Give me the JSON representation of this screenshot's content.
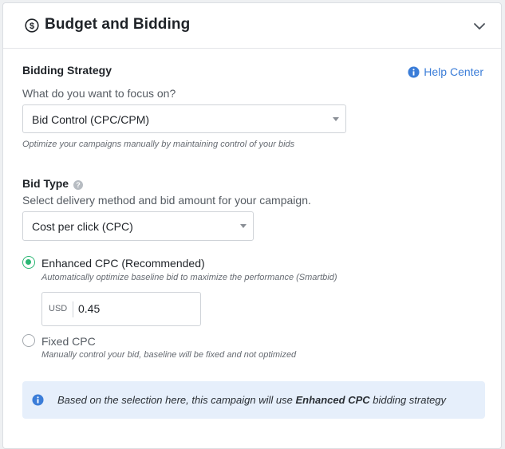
{
  "panel": {
    "title": "Budget and Bidding",
    "icon": "dollar-circle-icon",
    "collapse_icon": "chevron-down-icon"
  },
  "bidding_strategy": {
    "title": "Bidding Strategy",
    "help_label": "Help Center",
    "question": "What do you want to focus on?",
    "selected": "Bid Control (CPC/CPM)",
    "hint": "Optimize your campaigns manually by maintaining control of your bids"
  },
  "bid_type": {
    "title": "Bid Type",
    "description": "Select delivery method and bid amount for your campaign.",
    "selected": "Cost per click (CPC)",
    "options": [
      {
        "label": "Enhanced CPC (Recommended)",
        "description": "Automatically optimize baseline bid to maximize the performance (Smartbid)",
        "checked": true
      },
      {
        "label": "Fixed CPC",
        "description": "Manually control your bid, baseline will be fixed and not optimized",
        "checked": false
      }
    ],
    "bid": {
      "currency": "USD",
      "value": "0.45"
    }
  },
  "info": {
    "prefix": "Based on the selection here, this campaign will use ",
    "emphasis": "Enhanced CPC",
    "suffix": " bidding strategy"
  },
  "colors": {
    "accent_green": "#2bb673",
    "link_blue": "#3b7dd8",
    "info_bg": "#e6effb"
  }
}
